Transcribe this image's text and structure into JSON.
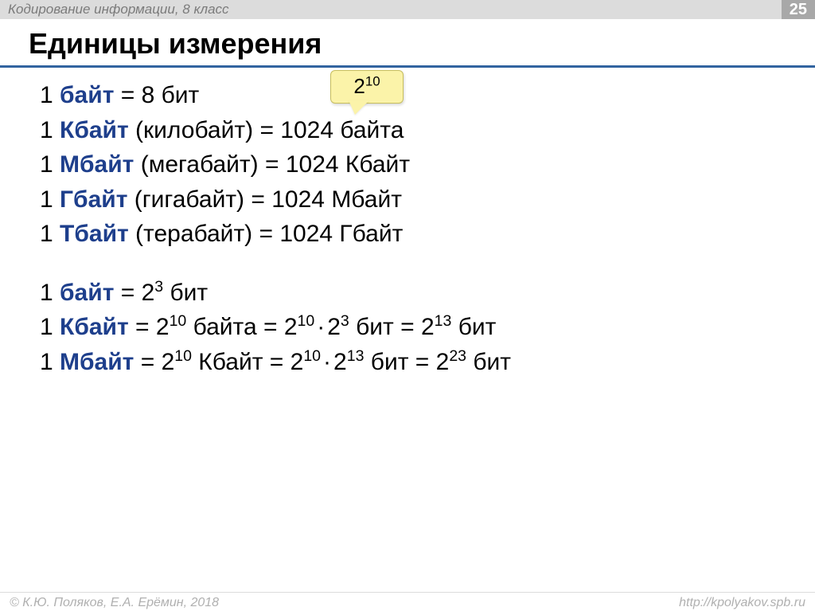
{
  "header": {
    "subject": "Кодирование информации, 8 класс",
    "page": "25"
  },
  "title": "Единицы измерения",
  "callout": {
    "base": "2",
    "exp": "10"
  },
  "block1": [
    {
      "one": "1 ",
      "term": "байт",
      "rest": " = 8 бит"
    },
    {
      "one": "1 ",
      "term": "Кбайт",
      "rest": " (килобайт) = 1024 байта"
    },
    {
      "one": "1 ",
      "term": "Мбайт",
      "rest": " (мегабайт) = 1024 Кбайт"
    },
    {
      "one": "1 ",
      "term": "Гбайт",
      "rest": " (гигабайт) = 1024 Мбайт"
    },
    {
      "one": "1 ",
      "term": "Тбайт",
      "rest": " (терабайт) = 1024 Гбайт"
    }
  ],
  "block2": [
    {
      "one": "1 ",
      "term": "байт",
      "parts": [
        {
          "t": " = 2"
        },
        {
          "sup": "3"
        },
        {
          "t": " бит"
        }
      ]
    },
    {
      "one": "1 ",
      "term": "Кбайт",
      "parts": [
        {
          "t": " = 2"
        },
        {
          "sup": "10"
        },
        {
          "t": " байта = 2"
        },
        {
          "sup": "10"
        },
        {
          "dot": "·"
        },
        {
          "t": "2"
        },
        {
          "sup": "3"
        },
        {
          "t": " бит = 2"
        },
        {
          "sup": "13"
        },
        {
          "t": " бит"
        }
      ]
    },
    {
      "one": "1 ",
      "term": "Мбайт",
      "parts": [
        {
          "t": " = 2"
        },
        {
          "sup": "10"
        },
        {
          "t": " Кбайт = 2"
        },
        {
          "sup": "10"
        },
        {
          "dot": "·"
        },
        {
          "t": "2"
        },
        {
          "sup": "13"
        },
        {
          "t": "  бит = 2"
        },
        {
          "sup": "23"
        },
        {
          "t": " бит"
        }
      ]
    }
  ],
  "footer": {
    "left": "© К.Ю. Поляков, Е.А. Ерёмин, 2018",
    "right": "http://kpolyakov.spb.ru"
  }
}
